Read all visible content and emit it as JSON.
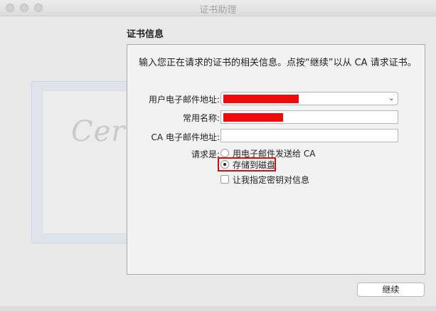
{
  "window": {
    "title": "证书助理"
  },
  "section": {
    "title": "证书信息"
  },
  "panel": {
    "intro": "输入您正在请求的证书的相关信息。点按“继续”以从 CA 请求证书。"
  },
  "form": {
    "email_label": "用户电子邮件地址:",
    "name_label": "常用名称:",
    "ca_email_label": "CA 电子邮件地址:",
    "request_label": "请求是:",
    "options": {
      "email_ca": "用电子邮件发送给 CA",
      "save_disk": "存储到磁盘",
      "specify_key": "让我指定密钥对信息"
    }
  },
  "buttons": {
    "continue": "继续"
  },
  "decoration": {
    "certificate_word": "Certificate"
  },
  "colors": {
    "redaction": "#f00b0b",
    "highlight": "#d90d0d"
  }
}
